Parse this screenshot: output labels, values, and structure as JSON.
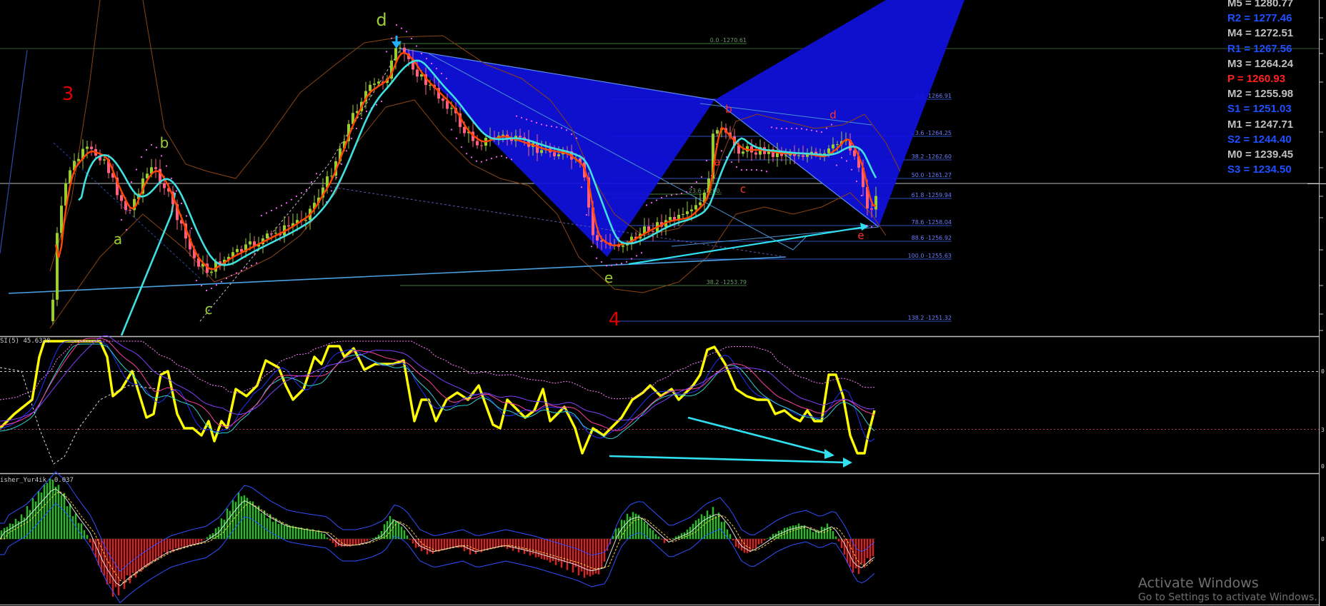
{
  "chart_data": {
    "type": "candlestick",
    "instrument_note": "",
    "price_panel": {
      "wave_labels": [
        {
          "text": "3",
          "color": "#e00000"
        },
        {
          "text": "4",
          "color": "#e00000"
        },
        {
          "text": "d",
          "color": "#9acd32"
        },
        {
          "text": "b",
          "color": "#9acd32"
        },
        {
          "text": "a",
          "color": "#9acd32"
        },
        {
          "text": "c",
          "color": "#9acd32"
        },
        {
          "text": "e",
          "color": "#9acd32"
        },
        {
          "text": "b",
          "color": "#ff3030"
        },
        {
          "text": "a",
          "color": "#ff3030"
        },
        {
          "text": "c",
          "color": "#ff3030"
        },
        {
          "text": "d",
          "color": "#ff3030"
        },
        {
          "text": "e",
          "color": "#ff3030"
        }
      ],
      "fibo_levels": [
        {
          "label": "0.0 -1270.61",
          "value": 1270.61
        },
        {
          "label": "0.0 -1266.91",
          "value": 1266.91
        },
        {
          "label": "23.6 -1264.25",
          "value": 1264.25
        },
        {
          "label": "38.2 -1262.60",
          "value": 1262.6
        },
        {
          "label": "50.0 -1261.27",
          "value": 1261.27
        },
        {
          "label": "23.6 -1260.",
          "value": 1260.0
        },
        {
          "label": "61.8 -1259.94",
          "value": 1259.94
        },
        {
          "label": "78.6 -1258.04",
          "value": 1258.04
        },
        {
          "label": "88.6 -1256.92",
          "value": 1256.92
        },
        {
          "label": "100.0 -1255.63",
          "value": 1255.63
        },
        {
          "label": "38.2 -1253.79",
          "value": 1253.79
        },
        {
          "label": "138.2 -1251.32",
          "value": 1251.32
        }
      ],
      "pivots": [
        {
          "label": "M5 = 1280.77",
          "color": "#c0c0c0"
        },
        {
          "label": "R2 = 1277.46",
          "color": "#1e50ff"
        },
        {
          "label": "M4 = 1272.51",
          "color": "#c0c0c0"
        },
        {
          "label": "R1 = 1267.56",
          "color": "#1e50ff"
        },
        {
          "label": "M3 = 1264.24",
          "color": "#c0c0c0"
        },
        {
          "label": "P  = 1260.93",
          "color": "#ff2020"
        },
        {
          "label": "M2 = 1255.98",
          "color": "#c0c0c0"
        },
        {
          "label": "S1 = 1251.03",
          "color": "#1e50ff"
        },
        {
          "label": "M1 = 1247.71",
          "color": "#c0c0c0"
        },
        {
          "label": "S2 = 1244.40",
          "color": "#1e50ff"
        },
        {
          "label": "M0 = 1239.45",
          "color": "#c0c0c0"
        },
        {
          "label": "S3 = 1234.50",
          "color": "#1e50ff"
        }
      ]
    },
    "rsi_panel": {
      "label": "SI(5) 45.6328",
      "right_ticks": [
        "0",
        "3",
        "0"
      ]
    },
    "fisher_panel": {
      "label": "isher_Yur4ik -0.037",
      "right_ticks": [
        "0"
      ]
    },
    "colors": {
      "bull_candle": "#9acd32",
      "bear_candle": "#ff6080",
      "fast_ma": "#ff4500",
      "slow_ma": "#40e0e0",
      "pattern_fill": "#1010e0",
      "rsi_line": "#ffff00",
      "divergence_arrow": "#30e0f0",
      "fisher_up": "#20c020",
      "fisher_down": "#e02020"
    }
  },
  "watermark": {
    "title": "Activate Windows",
    "subtitle": "Go to Settings to activate Windows."
  }
}
